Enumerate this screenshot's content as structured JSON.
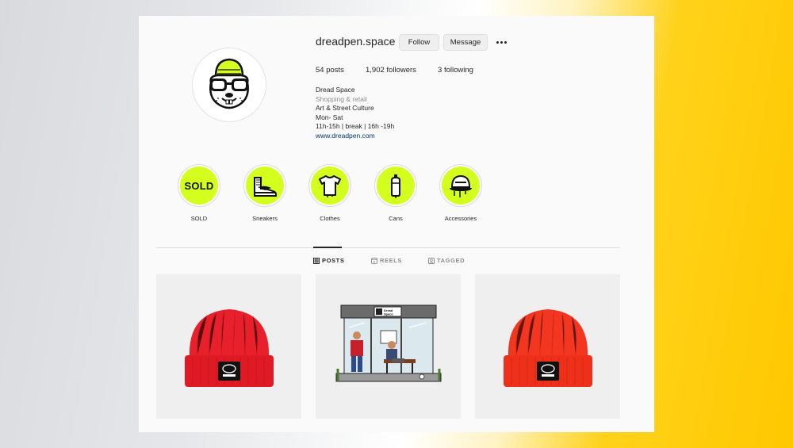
{
  "profile": {
    "username": "dreadpen.space",
    "follow_label": "Follow",
    "message_label": "Message",
    "stats": {
      "posts_count": "54",
      "posts_label": "posts",
      "followers_count": "1,902",
      "followers_label": "followers",
      "following_count": "3",
      "following_label": "following"
    },
    "bio": {
      "name": "Dread Space",
      "category": "Shopping & retail",
      "line1": "Art & Street Culture",
      "line2": "Mon- Sat",
      "line3": "11h-15h | break | 16h -19h",
      "link": "www.dreadpen.com"
    }
  },
  "highlights": [
    {
      "label": "SOLD",
      "icon": "sold-text-icon",
      "text": "SOLD"
    },
    {
      "label": "Sneakers",
      "icon": "sneaker-icon"
    },
    {
      "label": "Clothes",
      "icon": "tshirt-icon"
    },
    {
      "label": "Cans",
      "icon": "spray-can-icon"
    },
    {
      "label": "Accessories",
      "icon": "cap-icon"
    }
  ],
  "tabs": [
    {
      "label": "POSTS",
      "icon": "grid-icon",
      "active": true
    },
    {
      "label": "REELS",
      "icon": "reels-icon",
      "active": false
    },
    {
      "label": "TAGGED",
      "icon": "tagged-icon",
      "active": false
    }
  ],
  "posts": [
    {
      "subject": "red-beanie"
    },
    {
      "subject": "bus-stop-illustration",
      "sign_text": "Dread Space"
    },
    {
      "subject": "red-orange-beanie"
    }
  ],
  "colors": {
    "highlight_green": "#d4ff1e",
    "beanie_red": "#e8202c",
    "beanie_orange": "#f2361f",
    "link": "#00376b"
  }
}
